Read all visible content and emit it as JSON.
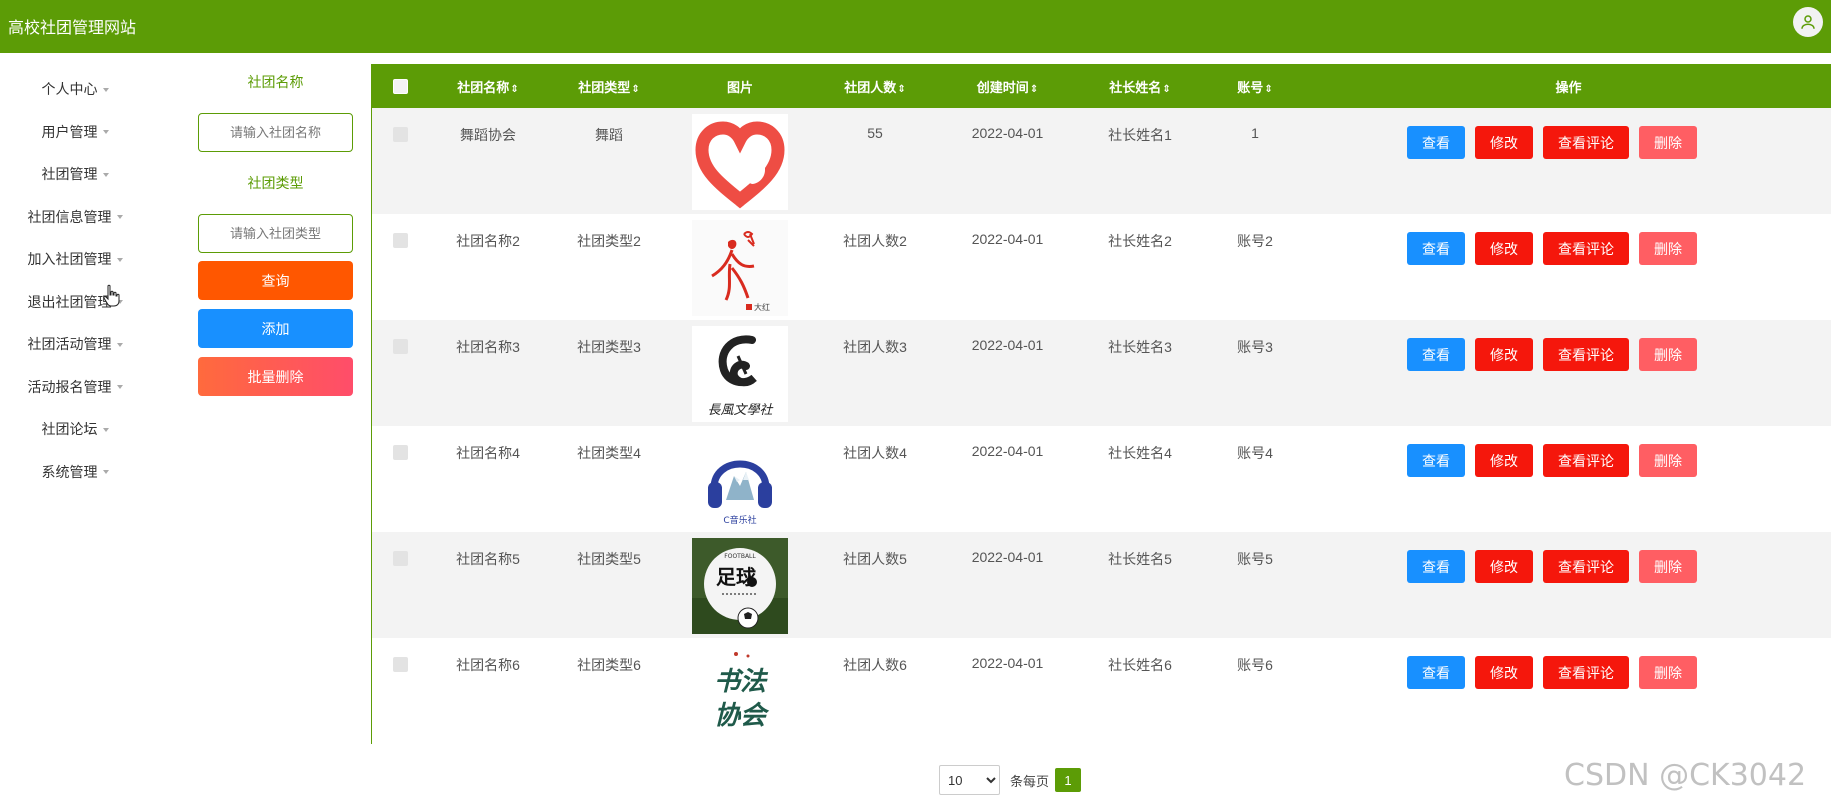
{
  "header": {
    "title": "高校社团管理网站"
  },
  "sidebar": {
    "items": [
      {
        "label": "个人中心"
      },
      {
        "label": "用户管理"
      },
      {
        "label": "社团管理"
      },
      {
        "label": "社团信息管理"
      },
      {
        "label": "加入社团管理"
      },
      {
        "label": "退出社团管理"
      },
      {
        "label": "社团活动管理"
      },
      {
        "label": "活动报名管理"
      },
      {
        "label": "社团论坛"
      },
      {
        "label": "系统管理"
      }
    ]
  },
  "search": {
    "name_label": "社团名称",
    "name_placeholder": "请输入社团名称",
    "type_label": "社团类型",
    "type_placeholder": "请输入社团类型",
    "query_label": "查询",
    "add_label": "添加",
    "batch_delete_label": "批量删除"
  },
  "table": {
    "columns": [
      "社团名称",
      "社团类型",
      "图片",
      "社团人数",
      "创建时间",
      "社长姓名",
      "账号",
      "操作"
    ],
    "rows": [
      {
        "name": "舞蹈协会",
        "type": "舞蹈",
        "count": "55",
        "created": "2022-04-01",
        "leader": "社长姓名1",
        "account": "1",
        "image": "heart-hand-logo"
      },
      {
        "name": "社团名称2",
        "type": "社团类型2",
        "count": "社团人数2",
        "created": "2022-04-01",
        "leader": "社长姓名2",
        "account": "账号2",
        "image": "dancer-logo"
      },
      {
        "name": "社团名称3",
        "type": "社团类型3",
        "count": "社团人数3",
        "created": "2022-04-01",
        "leader": "社长姓名3",
        "account": "账号3",
        "image": "literature-club-logo"
      },
      {
        "name": "社团名称4",
        "type": "社团类型4",
        "count": "社团人数4",
        "created": "2022-04-01",
        "leader": "社长姓名4",
        "account": "账号4",
        "image": "headphones-logo"
      },
      {
        "name": "社团名称5",
        "type": "社团类型5",
        "count": "社团人数5",
        "created": "2022-04-01",
        "leader": "社长姓名5",
        "account": "账号5",
        "image": "football-logo"
      },
      {
        "name": "社团名称6",
        "type": "社团类型6",
        "count": "社团人数6",
        "created": "2022-04-01",
        "leader": "社长姓名6",
        "account": "账号6",
        "image": "calligraphy-logo"
      }
    ],
    "actions": {
      "view": "查看",
      "edit": "修改",
      "comments": "查看评论",
      "delete": "删除"
    },
    "image_texts": {
      "dancer_tag": "大红",
      "literature": "長風文學社",
      "music": "C音乐社",
      "football_top": "FOOTBALL",
      "football_main": "足球",
      "calligraphy_1": "书法",
      "calligraphy_2": "协会"
    }
  },
  "pagination": {
    "page_size": "10",
    "per_page_label": "条每页",
    "current_page": "1"
  },
  "watermark": "CSDN @CK3042",
  "colors": {
    "primary": "#5c9c06",
    "query": "#ff5700",
    "add": "#1890ff",
    "danger": "#f5170c",
    "delete": "#ff5e63"
  }
}
